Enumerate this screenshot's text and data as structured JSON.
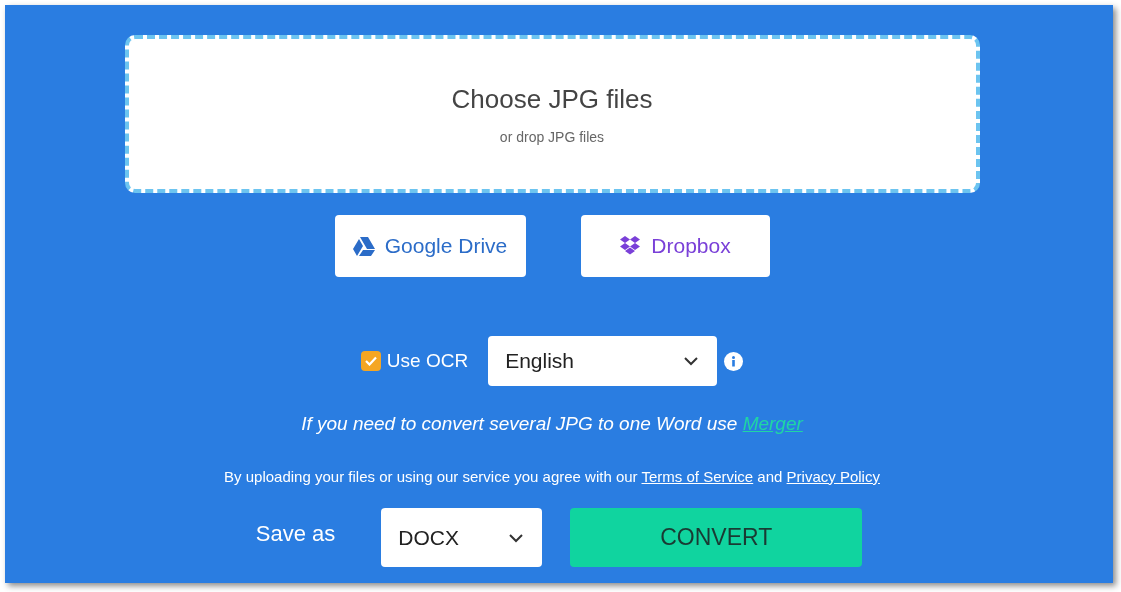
{
  "dropzone": {
    "title": "Choose JPG files",
    "subtitle": "or drop JPG files"
  },
  "cloud_buttons": [
    {
      "kind": "drive",
      "label": "Google Drive"
    },
    {
      "kind": "dropbox",
      "label": "Dropbox"
    }
  ],
  "ocr": {
    "checked": true,
    "label": "Use OCR",
    "language": "English"
  },
  "merge_note": {
    "text": "If you need to convert several JPG to one Word use",
    "link": "Merger"
  },
  "terms": {
    "text": "By uploading your files or using our service you agree with our",
    "link_1": "Terms of Service",
    "joiner": "and",
    "link_2": "Privacy Policy"
  },
  "save": {
    "label": "Save as",
    "format": "DOCX",
    "button": "CONVERT"
  }
}
